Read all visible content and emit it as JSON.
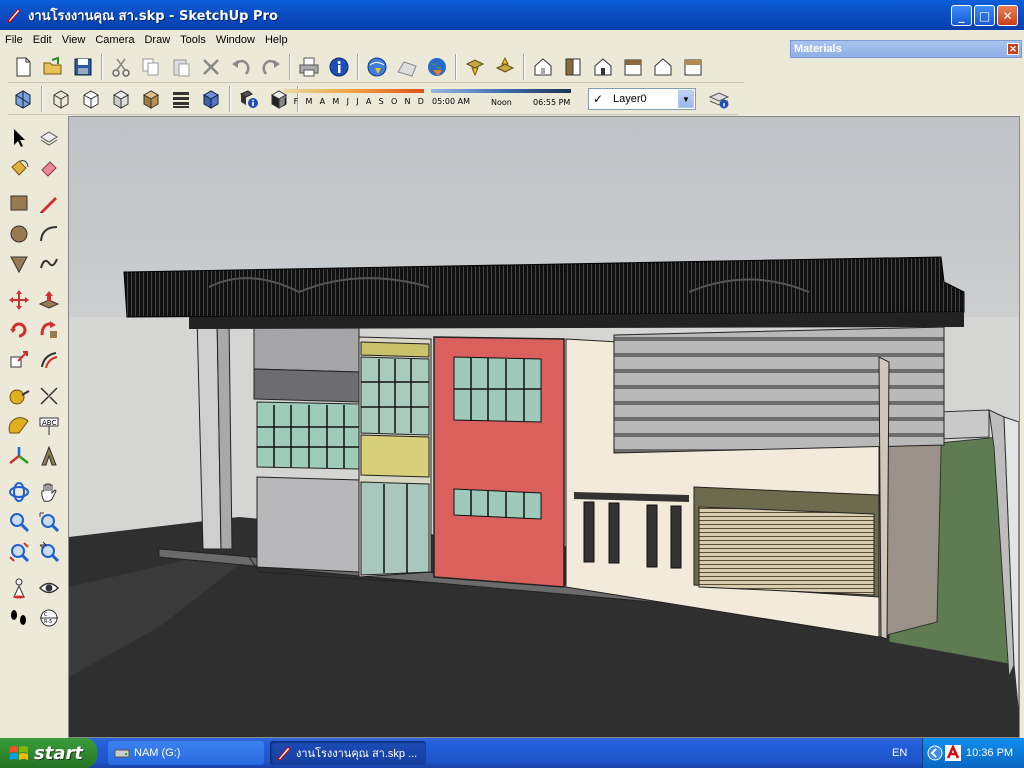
{
  "window": {
    "title": "งานโรงงานคุณ สา.skp - SketchUp Pro",
    "controls": {
      "minimize": "_",
      "maximize": "□",
      "close": "✕"
    }
  },
  "menu": [
    "File",
    "Edit",
    "View",
    "Camera",
    "Draw",
    "Tools",
    "Window",
    "Help"
  ],
  "materials_panel": {
    "title": "Materials",
    "close": "✕"
  },
  "shadow_settings": {
    "months": [
      "J",
      "F",
      "M",
      "A",
      "M",
      "J",
      "J",
      "A",
      "S",
      "O",
      "N",
      "D"
    ],
    "sunrise": "05:00 AM",
    "noon": "Noon",
    "sunset": "06:55 PM"
  },
  "layer": {
    "current": "Layer0",
    "check": "✓"
  },
  "taskbar": {
    "start_label": "start",
    "tasks": [
      {
        "label": "NAM (G:)",
        "icon": "drive-icon"
      },
      {
        "label": "งานโรงงานคุณ สา.skp ...",
        "icon": "sketchup-icon"
      }
    ],
    "language": "EN",
    "clock": "10:36 PM"
  },
  "colors": {
    "titlebar": "#0b4fc5",
    "sky_top": "#c4c7cb",
    "ground": "#2f2f2f",
    "accent_red": "#d9605c",
    "grass": "#5e7b52"
  }
}
